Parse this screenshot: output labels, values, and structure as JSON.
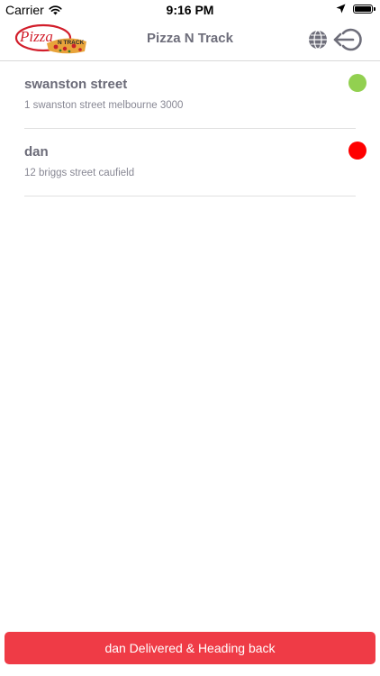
{
  "status_bar": {
    "carrier": "Carrier",
    "time": "9:16 PM",
    "icons": [
      "wifi-icon",
      "location-arrow-icon",
      "battery-icon"
    ]
  },
  "header": {
    "logo_text": "Pizza",
    "logo_subtext": "N TRACK",
    "title": "Pizza N Track",
    "icons": [
      "globe-icon",
      "logout-icon"
    ]
  },
  "orders": [
    {
      "name": "swanston street",
      "address": "1 swanston street melbourne 3000",
      "status_color": "#92d050"
    },
    {
      "name": "dan",
      "address": "12 briggs street caufield",
      "status_color": "#ff0000"
    }
  ],
  "footer": {
    "action_label": "dan Delivered & Heading back",
    "action_color": "#ef3b46"
  }
}
